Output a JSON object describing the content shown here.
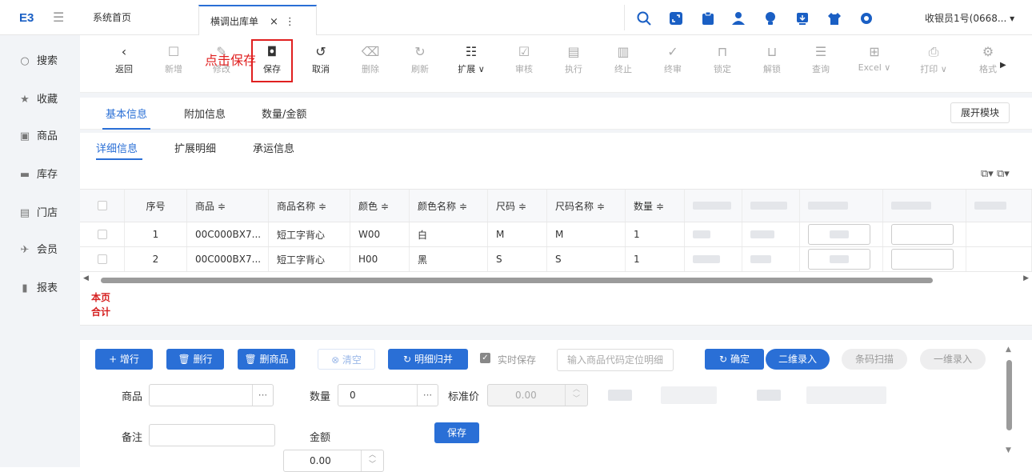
{
  "topbar": {
    "logo": "E3",
    "tabs": {
      "home": "系统首页",
      "active": "横调出库单"
    },
    "user": "收银员1号(0668...",
    "tab_close": "×",
    "tab_more": "⋮"
  },
  "sidebar": {
    "items": [
      "搜索",
      "收藏",
      "商品",
      "库存",
      "门店",
      "会员",
      "报表"
    ]
  },
  "toolbar": {
    "items": [
      "返回",
      "新增",
      "修改",
      "保存",
      "取消",
      "删除",
      "刷新",
      "扩展 ∨",
      "审核",
      "执行",
      "终止",
      "终审",
      "锁定",
      "解锁",
      "查询",
      "Excel ∨",
      "打印 ∨",
      "格式"
    ],
    "annotation": "点击保存"
  },
  "tabs_level1": {
    "basic": "基本信息",
    "extra": "附加信息",
    "qty": "数量/金额",
    "expand": "展开模块"
  },
  "tabs_level2": {
    "detail": "详细信息",
    "ext": "扩展明细",
    "ship": "承运信息"
  },
  "grid": {
    "headers": [
      "序号",
      "商品 ≑",
      "商品名称 ≑",
      "颜色 ≑",
      "颜色名称 ≑",
      "尺码 ≑",
      "尺码名称 ≑",
      "数量 ≑"
    ],
    "rows": [
      [
        "1",
        "00C000BX7...",
        "短工字背心",
        "W00",
        "白",
        "M",
        "M",
        "1"
      ],
      [
        "2",
        "00C000BX7...",
        "短工字背心",
        "H00",
        "黑",
        "S",
        "S",
        "1"
      ]
    ],
    "totals_label_1": "本页",
    "totals_label_2": "合计"
  },
  "bottom": {
    "buttons": {
      "add_row": "+ 增行",
      "del_row": "删行",
      "del_goods": "删商品",
      "clear": "⊗ 清空",
      "merge": "明细归并",
      "confirm": "确定",
      "two_dim": "二维录入",
      "barcode": "条码扫描",
      "one_dim": "一维录入",
      "save": "保存"
    },
    "realtime_save": "实时保存",
    "locate_placeholder": "输入商品代码定位明细",
    "form": {
      "goods": "商品",
      "qty": "数量",
      "qty_value": "0",
      "std_price": "标准价",
      "std_price_value": "0.00",
      "remark": "备注",
      "amount": "金额",
      "amount_value": "0.00"
    }
  },
  "colors": {
    "accent": "#2a6fd6",
    "highlight": "#e02020"
  }
}
